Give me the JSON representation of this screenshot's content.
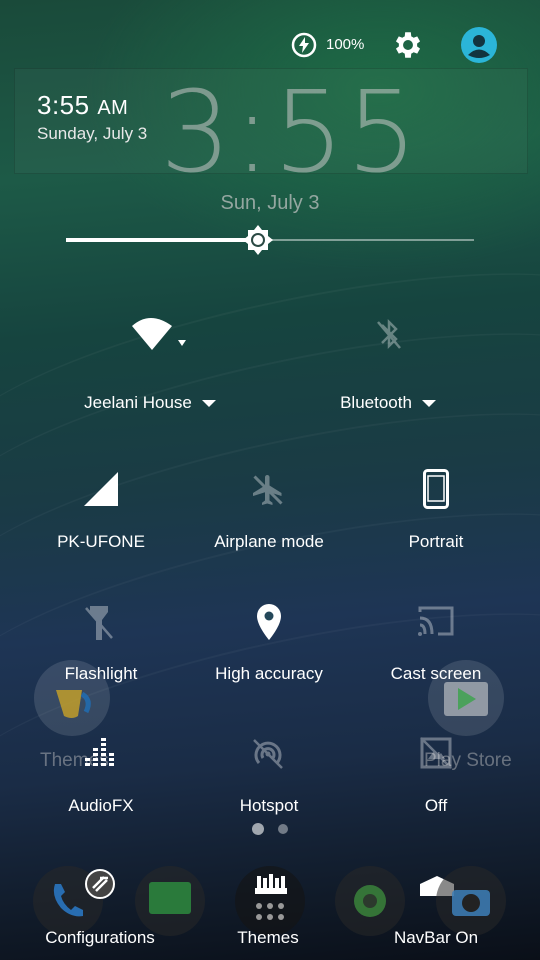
{
  "status": {
    "battery_text": "100%",
    "time_small": "3:55",
    "time_ampm": "AM",
    "date_small": "Sunday, July 3",
    "big_clock": "3:55",
    "date_center": "Sun, July 3"
  },
  "brightness": {
    "level": 0.47
  },
  "tiles": [
    {
      "label": "Jeelani House",
      "icon": "wifi-icon",
      "has_dropdown": true,
      "active": true
    },
    {
      "label": "Bluetooth",
      "icon": "bluetooth-icon",
      "has_dropdown": true,
      "active": false
    },
    {
      "label": "PK-UFONE",
      "icon": "cellular-signal-icon",
      "active": true
    },
    {
      "label": "Airplane mode",
      "icon": "airplane-icon",
      "active": false
    },
    {
      "label": "Portrait",
      "icon": "phone-portrait-icon",
      "active": true
    },
    {
      "label": "Flashlight",
      "icon": "flashlight-icon",
      "active": false
    },
    {
      "label": "High accuracy",
      "icon": "location-pin-icon",
      "active": true
    },
    {
      "label": "Cast screen",
      "icon": "cast-icon",
      "active": false
    },
    {
      "label": "AudioFX",
      "icon": "equalizer-icon",
      "active": true
    },
    {
      "label": "Hotspot",
      "icon": "hotspot-icon",
      "active": false
    },
    {
      "label": "Off",
      "icon": "screen-off-icon",
      "active": false
    }
  ],
  "pages": {
    "count": 2,
    "current": 1
  },
  "home_screen": {
    "app_labels": [
      "Themes",
      "Play Store"
    ],
    "dock_labels": [
      "Configurations",
      "Themes",
      "NavBar On"
    ]
  }
}
